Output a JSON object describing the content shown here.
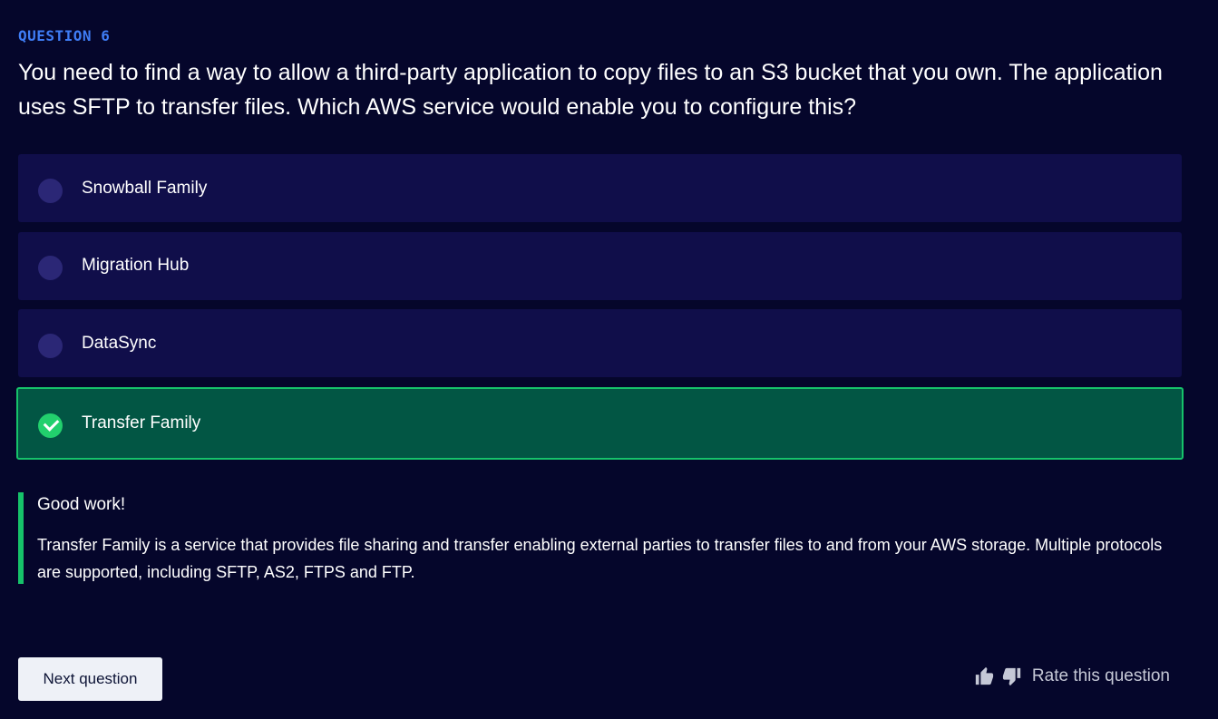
{
  "question": {
    "label": "QUESTION 6",
    "text": "You need to find a way to allow a third-party application to copy files to an S3 bucket that you own. The application uses SFTP to transfer files. Which AWS service would enable you to configure this?"
  },
  "options": [
    {
      "label": "Snowball Family",
      "state": "unselected"
    },
    {
      "label": "Migration Hub",
      "state": "unselected"
    },
    {
      "label": "DataSync",
      "state": "unselected"
    },
    {
      "label": "Transfer Family",
      "state": "correct"
    }
  ],
  "feedback": {
    "title": "Good work!",
    "text": "Transfer Family is a service that provides file sharing and transfer enabling external parties to transfer files to and from your AWS storage. Multiple protocols are supported, including SFTP, AS2, FTPS and FTP."
  },
  "footer": {
    "next_label": "Next question",
    "rate_label": "Rate this question",
    "icons": [
      "thumbs-up-icon",
      "thumbs-down-icon"
    ]
  },
  "colors": {
    "background": "#05062b",
    "accent_blue": "#3f7df5",
    "option_bg": "#100e4a",
    "correct_bg": "#025644",
    "correct_border": "#16c26a"
  }
}
